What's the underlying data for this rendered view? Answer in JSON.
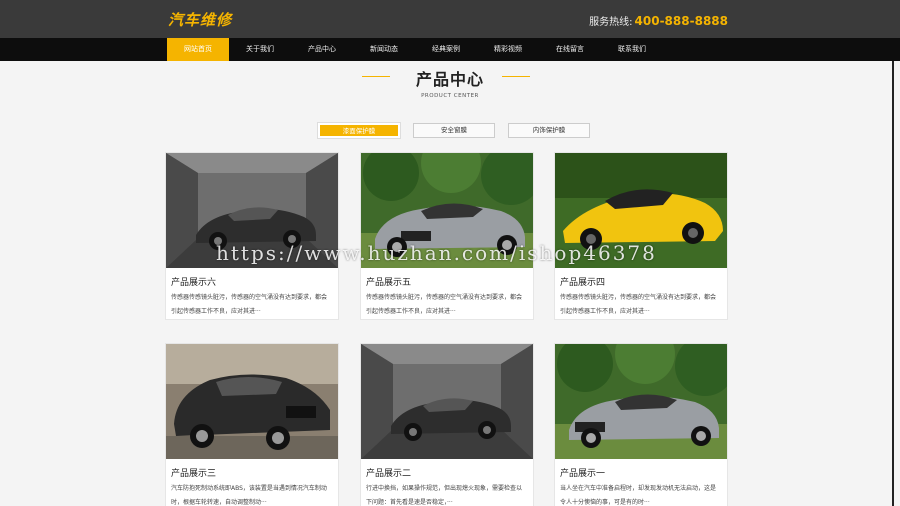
{
  "header": {
    "logo_text": "汽车维修",
    "hotline_label": "服务热线:",
    "hotline_number": "400-888-8888"
  },
  "nav": {
    "items": [
      {
        "label": "网站首页"
      },
      {
        "label": "关于我们"
      },
      {
        "label": "产品中心"
      },
      {
        "label": "新闻动态"
      },
      {
        "label": "经典案例"
      },
      {
        "label": "精彩视频"
      },
      {
        "label": "在线留言"
      },
      {
        "label": "联系我们"
      }
    ]
  },
  "section": {
    "title": "产品中心",
    "subtitle": "PRODUCT CENTER"
  },
  "tabs": [
    {
      "label": "漆面保护膜"
    },
    {
      "label": "安全窗膜"
    },
    {
      "label": "内饰保护膜"
    }
  ],
  "products": [
    {
      "name": "产品展示六",
      "desc": "传感器传感镜头脏污，传感器的空气涌没有达到要求，都会引起传感器工作不良，应对其进···"
    },
    {
      "name": "产品展示五",
      "desc": "传感器传感镜头脏污，传感器的空气涌没有达到要求，都会引起传感器工作不良，应对其进···"
    },
    {
      "name": "产品展示四",
      "desc": "传感器传感镜头脏污，传感器的空气涌没有达到要求，都会引起传感器工作不良，应对其进···"
    },
    {
      "name": "产品展示三",
      "desc": "汽车防抱死制动系统即ABS，该装置是当遇到情况汽车制动时，根据车轮转速，自动调整制动···"
    },
    {
      "name": "产品展示二",
      "desc": "行进中换挡，如果操作规范，但出现熄火现象，需要检查以下问题：首先看是速是否稳定，···"
    },
    {
      "name": "产品展示一",
      "desc": "当人坐在汽车中准备启程时，却发现发动机无法启动，这是令人十分懊恼的事，可是有的时···"
    }
  ],
  "watermark": "https://www.huzhan.com/ishop46378",
  "colors": {
    "accent": "#f5b400",
    "topbar": "#3a3a3a",
    "nav": "#0d0d0d"
  }
}
